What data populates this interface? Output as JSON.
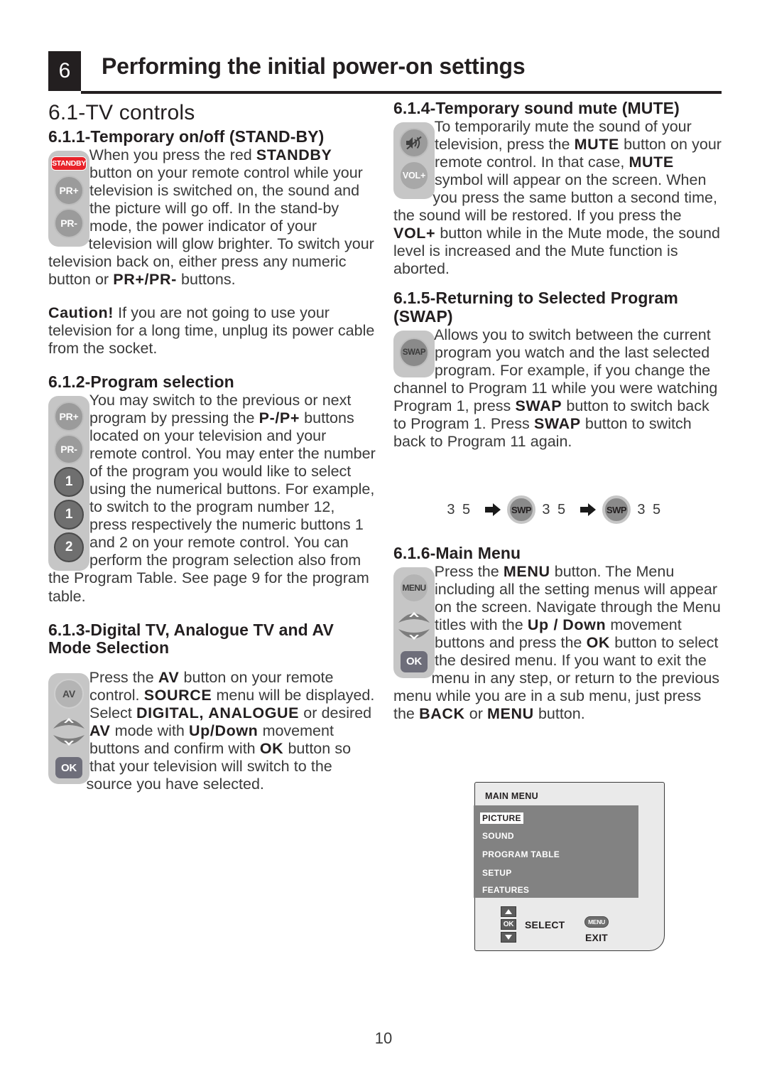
{
  "chapter": {
    "number": "6",
    "title": "Performing the initial power-on settings"
  },
  "section": {
    "title": "6.1-TV controls"
  },
  "subsections": {
    "s611": {
      "heading": "6.1.1-Temporary on/off (STAND-BY)",
      "paragraph_1_pre": "When you press the red ",
      "paragraph_1_b1": "STANDBY",
      "paragraph_1_mid": " button on your remote control while your television is switched on, the sound and the picture will go off. In the stand-by mode, the power indicator of your television will glow brighter. To switch your television back on, either press any numeric button or ",
      "paragraph_1_b2": "PR+/PR-",
      "paragraph_1_post": " buttons.",
      "caution_label": "Caution!",
      "caution_text": " If you are not going to use your television for a long time, unplug its power cable from the socket.",
      "buttons": {
        "standby": "STANDBY",
        "pr_plus": "PR+",
        "pr_minus": "PR-"
      }
    },
    "s612": {
      "heading": "6.1.2-Program selection",
      "paragraph_pre": "You may switch to the previous or next program by pressing the ",
      "paragraph_b1": "P-/P+",
      "paragraph_post": " buttons located on your television and your remote control. You may enter the number of the program you would like to select using the numerical buttons. For example, to switch to the program number 12, press respectively the numeric buttons 1 and 2 on your remote control. You can perform the program selection also from the Program Table. See page 9 for the program table.",
      "buttons": {
        "pr_plus": "PR+",
        "pr_minus": "PR-",
        "num_1": "1",
        "num_1b": "1",
        "num_2": "2"
      }
    },
    "s613": {
      "heading": "6.1.3-Digital TV, Analogue TV and AV Mode Selection",
      "p_pre": "Press the ",
      "p_b1": "AV",
      "p_m1": " button on your remote control. ",
      "p_b2": "SOURCE",
      "p_m2": " menu will be displayed. Select ",
      "p_b3": "DIGITAL,",
      "p_m3": " ",
      "p_b4": "ANALOGUE",
      "p_m4": " or desired ",
      "p_b5": "AV",
      "p_m5": " mode with ",
      "p_b6": "Up/Down",
      "p_m6": " movement buttons and confirm with ",
      "p_b7": "OK",
      "p_post": " button so that your television will switch to the source you have selected.",
      "buttons": {
        "av": "AV",
        "up": "up-chevron",
        "down": "down-chevron",
        "ok": "OK"
      }
    },
    "s614": {
      "heading": "6.1.4-Temporary sound mute (MUTE)",
      "p_pre": "To temporarily mute the sound of your television, press the ",
      "p_b1": "MUTE",
      "p_m1": " button on your remote control. In that case, ",
      "p_b2": "MUTE",
      "p_m2": " symbol will appear on the screen. When you press the same button a second time, the sound will be restored. If you press the ",
      "p_b3": "VOL+",
      "p_post": " button while in the Mute mode, the sound level is increased and the Mute function is aborted.",
      "buttons": {
        "mute": "mute-speaker",
        "vol_plus": "VOL+"
      }
    },
    "s615": {
      "heading": "6.1.5-Returning to Selected Program (SWAP)",
      "p_pre": "Allows you to switch between the current program you watch and the last selected program. For example, if you change the channel to Program 11 while you were watching Program 1, press ",
      "p_b1": "SWAP",
      "p_m1": " button to switch back to Program 1. Press ",
      "p_b2": "SWAP",
      "p_post": " button to switch back to Program 11 again.",
      "buttons": {
        "swap": "SWAP"
      },
      "demo": {
        "num_1": "3 5",
        "btn_1": "SWP",
        "num_2": "3 5",
        "btn_2": "SWP",
        "num_3": "3 5"
      }
    },
    "s616": {
      "heading": "6.1.6-Main Menu",
      "p_pre": "Press the ",
      "p_b1": "MENU",
      "p_m1": " button. The Menu including all the setting menus will appear on the screen. Navigate through the Menu titles with the ",
      "p_b2": "Up /",
      "p_m2": " ",
      "p_b3": "Down",
      "p_m3": " movement buttons and press the ",
      "p_b4": "OK",
      "p_m4": " button to select the desired menu. If you want to exit the menu in any step, or return to the previous menu while you are in a sub menu, just press the ",
      "p_b5": "BACK",
      "p_m5": " or ",
      "p_b6": "MENU",
      "p_post": " button.",
      "buttons": {
        "menu": "MENU",
        "up": "up-chevron",
        "down": "down-chevron",
        "ok": "OK"
      }
    }
  },
  "tv_menu": {
    "title": "MAIN MENU",
    "items": [
      {
        "label": "PICTURE",
        "selected": true
      },
      {
        "label": "SOUND",
        "selected": false
      },
      {
        "label": "PROGRAM TABLE",
        "selected": false
      },
      {
        "label": "SETUP",
        "selected": false
      },
      {
        "label": "FEATURES",
        "selected": false
      }
    ],
    "footer": {
      "ok_badge": "OK",
      "select_label": "SELECT",
      "menu_badge": "MENU",
      "exit_label": "EXIT"
    }
  },
  "footer": {
    "page_number": "10"
  },
  "colors": {
    "ink": "#231f20",
    "body": "#3a3a3a",
    "standby_red": "#e8232a",
    "pad_gray": "#c6c6c6",
    "menu_body_gray": "#828282",
    "screen_gray": "#eaeaea"
  }
}
